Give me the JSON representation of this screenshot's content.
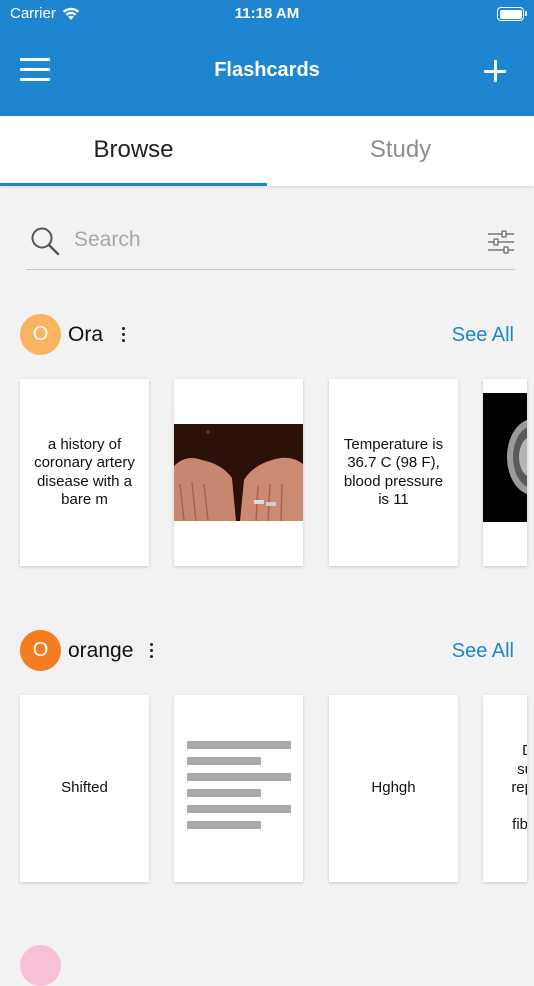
{
  "status_bar": {
    "carrier": "Carrier",
    "time": "11:18 AM"
  },
  "nav": {
    "title": "Flashcards",
    "menu_icon": "hamburger-menu-icon",
    "add_icon": "plus-icon"
  },
  "tabs": [
    {
      "label": "Browse",
      "active": true
    },
    {
      "label": "Study",
      "active": false
    }
  ],
  "search": {
    "placeholder": "Search"
  },
  "colors": {
    "primary": "#1e86d0",
    "avatar_ora": "#f9b462",
    "avatar_orange": "#f57c1f",
    "avatar_next": "#f7c0d6"
  },
  "decks": [
    {
      "initial": "O",
      "name": "Ora",
      "see_all": "See All",
      "cards": [
        {
          "type": "text",
          "text": "a history of coronary artery disease with a bare m"
        },
        {
          "type": "image",
          "image": "hands-photo"
        },
        {
          "type": "text",
          "text": "Temperature is 36.7 C (98 F), blood pressure is 11"
        },
        {
          "type": "image",
          "image": "brain-mri-scan"
        }
      ]
    },
    {
      "initial": "O",
      "name": "orange",
      "see_all": "See All",
      "cards": [
        {
          "type": "text",
          "text": "Shifted"
        },
        {
          "type": "image",
          "image": "text-lines-placeholder"
        },
        {
          "type": "text",
          "text": "Hghgh"
        },
        {
          "type": "text",
          "text": "D su rep fibr"
        }
      ]
    }
  ]
}
